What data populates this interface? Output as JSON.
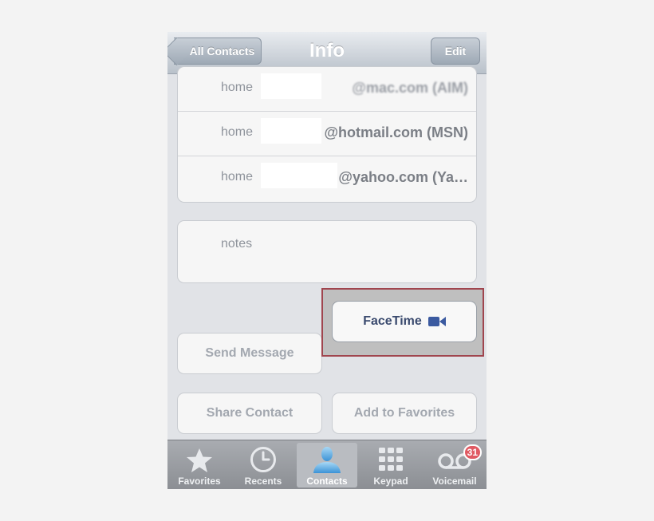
{
  "nav": {
    "back_label": "All Contacts",
    "title": "Info",
    "edit_label": "Edit"
  },
  "emails": [
    {
      "label": "home",
      "value": "@mac.com (AIM)"
    },
    {
      "label": "home",
      "value": "@hotmail.com (MSN)"
    },
    {
      "label": "home",
      "value": "@yahoo.com (Ya…"
    }
  ],
  "notes": {
    "label": "notes"
  },
  "actions": {
    "send_message": "Send Message",
    "facetime": "FaceTime",
    "share_contact": "Share Contact",
    "add_to_favorites": "Add to Favorites"
  },
  "tabs": [
    {
      "label": "Favorites",
      "icon": "star-icon"
    },
    {
      "label": "Recents",
      "icon": "clock-icon"
    },
    {
      "label": "Contacts",
      "icon": "person-icon",
      "active": true
    },
    {
      "label": "Keypad",
      "icon": "keypad-icon"
    },
    {
      "label": "Voicemail",
      "icon": "voicemail-icon",
      "badge": "31"
    }
  ],
  "colors": {
    "highlight": "#a0454e",
    "badge": "#e05a63",
    "facetime_icon": "#3b5aa0"
  }
}
